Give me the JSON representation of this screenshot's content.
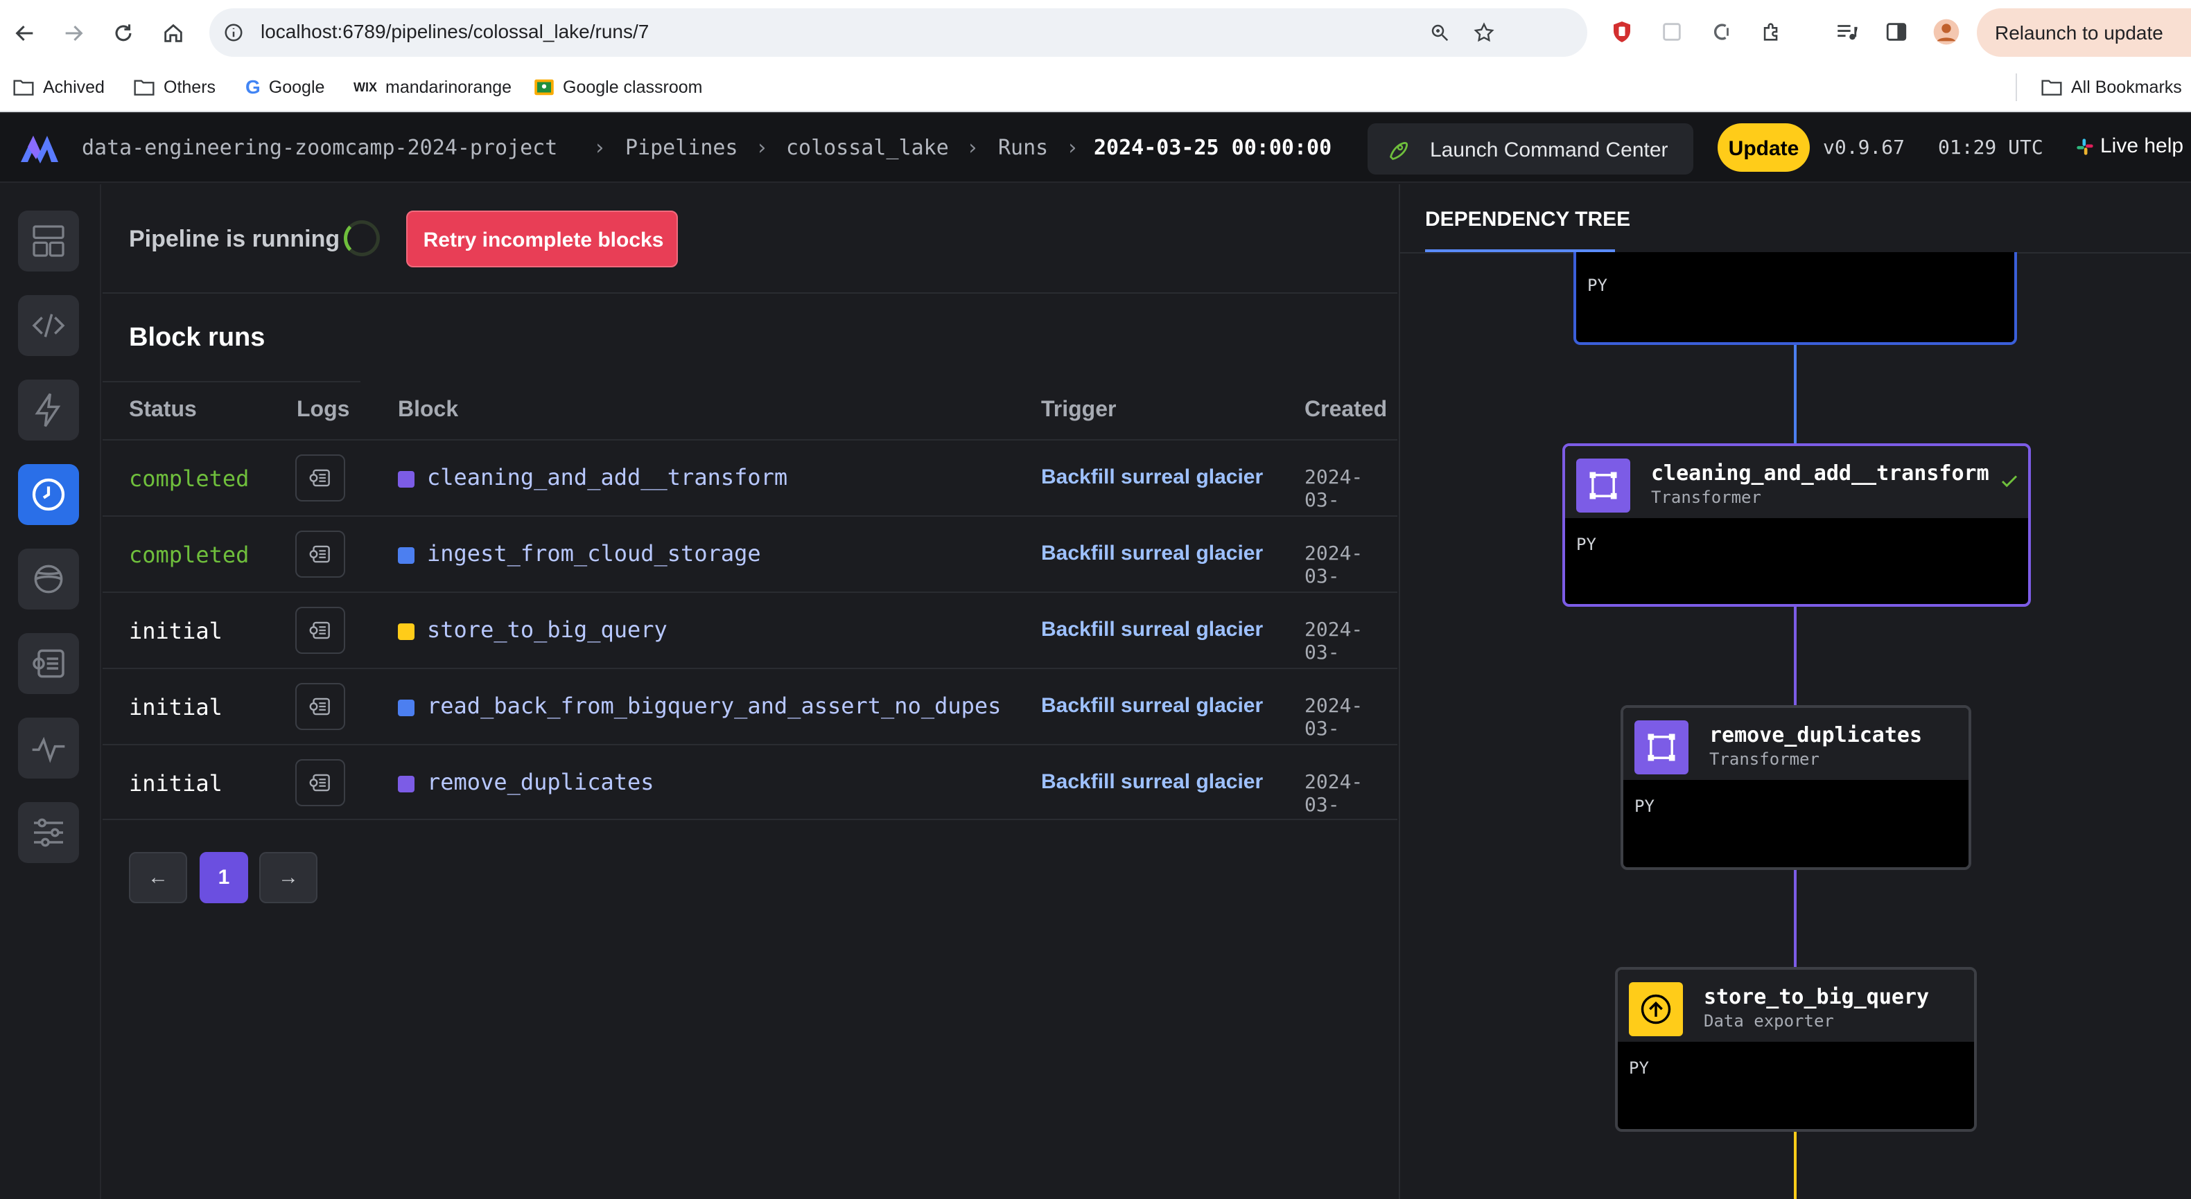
{
  "browser": {
    "url": "localhost:6789/pipelines/colossal_lake/runs/7",
    "relaunch_label": "Relaunch to update",
    "bookmarks": [
      {
        "label": "Achived",
        "icon": "folder-icon"
      },
      {
        "label": "Others",
        "icon": "folder-icon"
      },
      {
        "label": "Google",
        "icon": "google-icon"
      },
      {
        "label": "mandarinorange",
        "icon": "wix-icon"
      },
      {
        "label": "Google classroom",
        "icon": "classroom-icon"
      }
    ],
    "all_bookmarks_label": "All Bookmarks"
  },
  "header": {
    "breadcrumbs": [
      "data-engineering-zoomcamp-2024-project",
      "Pipelines",
      "colossal_lake",
      "Runs"
    ],
    "breadcrumb_current": "2024-03-25 00:00:00",
    "command_center_label": "Launch Command Center",
    "update_label": "Update",
    "version": "v0.9.67",
    "time": "01:29 UTC",
    "live_help_label": "Live help"
  },
  "nav": [
    {
      "name": "overview",
      "icon": "layout-icon",
      "active": false
    },
    {
      "name": "code",
      "icon": "code-icon",
      "active": false
    },
    {
      "name": "triggers",
      "icon": "lightning-icon",
      "active": false
    },
    {
      "name": "runs",
      "icon": "clock-icon",
      "active": true
    },
    {
      "name": "backfills",
      "icon": "planet-icon",
      "active": false
    },
    {
      "name": "logs",
      "icon": "log-icon",
      "active": false
    },
    {
      "name": "monitor",
      "icon": "pulse-icon",
      "active": false
    },
    {
      "name": "settings",
      "icon": "sliders-icon",
      "active": false
    }
  ],
  "main": {
    "status_text": "Pipeline is running",
    "retry_label": "Retry incomplete blocks",
    "section_title": "Block runs",
    "columns": [
      "Status",
      "Logs",
      "Block",
      "Trigger",
      "Created"
    ],
    "rows": [
      {
        "status": "completed",
        "block": "cleaning_and_add__transform",
        "color": "#7c5ce6",
        "trigger": "Backfill surreal glacier",
        "created": "2024-03-"
      },
      {
        "status": "completed",
        "block": "ingest_from_cloud_storage",
        "color": "#4c7ff0",
        "trigger": "Backfill surreal glacier",
        "created": "2024-03-"
      },
      {
        "status": "initial",
        "block": "store_to_big_query",
        "color": "#ffcc19",
        "trigger": "Backfill surreal glacier",
        "created": "2024-03-"
      },
      {
        "status": "initial",
        "block": "read_back_from_bigquery_and_assert_no_dupes",
        "color": "#4c7ff0",
        "trigger": "Backfill surreal glacier",
        "created": "2024-03-"
      },
      {
        "status": "initial",
        "block": "remove_duplicates",
        "color": "#7c5ce6",
        "trigger": "Backfill surreal glacier",
        "created": "2024-03-"
      }
    ],
    "pagination": {
      "prev_label": "←",
      "current_page": "1",
      "next_label": "→"
    }
  },
  "dependency_tree": {
    "tab_label": "DEPENDENCY TREE",
    "top_node_lang": "PY",
    "nodes": [
      {
        "title": "cleaning_and_add__transform",
        "type": "Transformer",
        "lang": "PY",
        "icon": "transformer-icon",
        "icon_color": "#7c5ce6",
        "completed": true
      },
      {
        "title": "remove_duplicates",
        "type": "Transformer",
        "lang": "PY",
        "icon": "transformer-icon",
        "icon_color": "#7c5ce6",
        "completed": false
      },
      {
        "title": "store_to_big_query",
        "type": "Data exporter",
        "lang": "PY",
        "icon": "upload-icon",
        "icon_color": "#ffcc19",
        "completed": false
      }
    ]
  }
}
